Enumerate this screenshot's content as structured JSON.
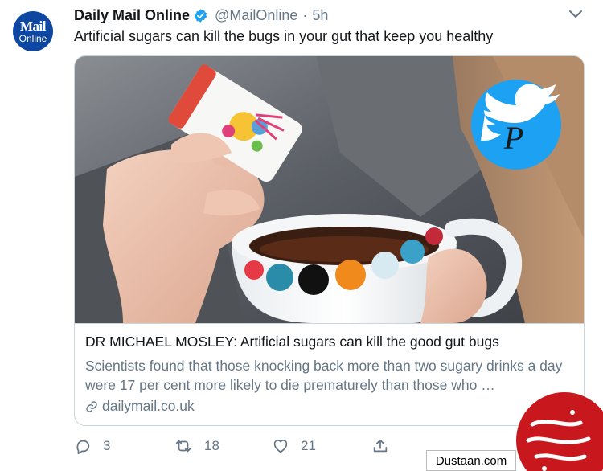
{
  "tweet": {
    "avatar": {
      "line1": "Mail",
      "line2": "Online"
    },
    "account_name": "Daily Mail Online",
    "handle": "@MailOnline",
    "separator": "·",
    "time": "5h",
    "text": "Artificial sugars can kill the bugs in your gut that keep you healthy"
  },
  "card": {
    "title": "DR MICHAEL MOSLEY: Artificial sugars can kill the good gut bugs",
    "description": "Scientists found that those knocking back more than two sugary drinks a day were 17 per cent more likely to die prematurely than those who …",
    "domain": "dailymail.co.uk",
    "image_overlay_letter": "P"
  },
  "actions": {
    "replies": "3",
    "retweets": "18",
    "likes": "21"
  },
  "watermark": {
    "site": "Dustaan.com"
  },
  "colors": {
    "twitter_blue": "#1da1f2",
    "secondary_text": "#657786",
    "border": "#ccd6dd",
    "mail_blue": "#0d47a1",
    "watermark_red": "#c8171d"
  },
  "icons": [
    "verified-badge-icon",
    "chevron-down-icon",
    "link-icon",
    "reply-icon",
    "retweet-icon",
    "like-icon",
    "share-icon",
    "twitter-bird-icon"
  ]
}
